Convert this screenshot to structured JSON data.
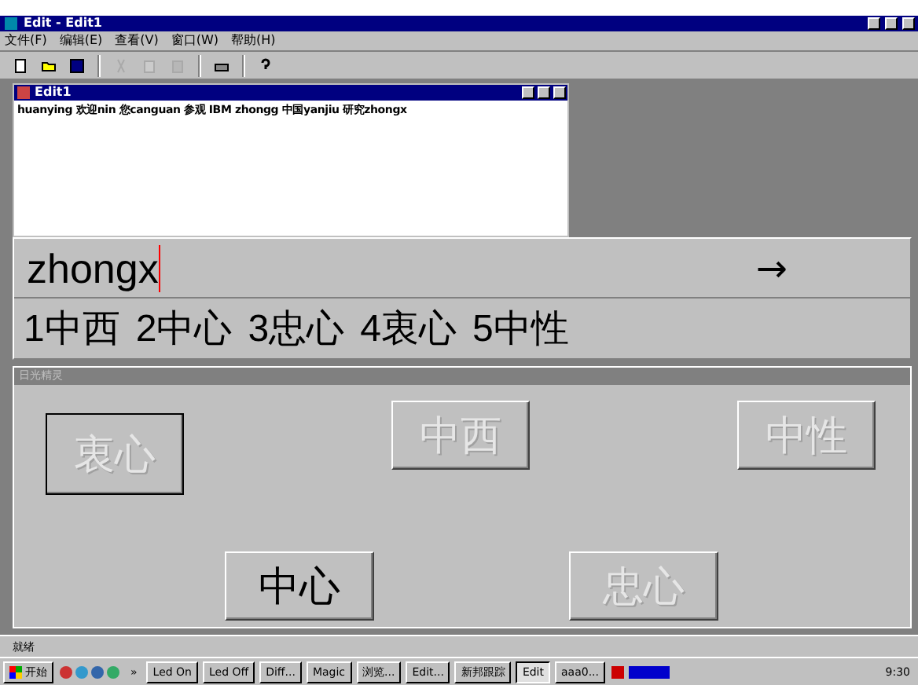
{
  "window": {
    "title": "Edit - Edit1"
  },
  "menu": [
    "文件(F)",
    "编辑(E)",
    "查看(V)",
    "窗口(W)",
    "帮助(H)"
  ],
  "toolbar": [
    {
      "kind": "new",
      "disabled": false
    },
    {
      "kind": "open",
      "disabled": false
    },
    {
      "kind": "save",
      "disabled": false
    },
    {
      "kind": "sep"
    },
    {
      "kind": "cut",
      "disabled": true
    },
    {
      "kind": "copy",
      "disabled": true
    },
    {
      "kind": "paste",
      "disabled": true
    },
    {
      "kind": "sep"
    },
    {
      "kind": "print",
      "disabled": false
    },
    {
      "kind": "sep"
    },
    {
      "kind": "help",
      "disabled": false
    }
  ],
  "child_window": {
    "title": "Edit1",
    "text": "huanying 欢迎nin 您canguan 参观 IBM zhongg 中国yanjiu 研究zhongx"
  },
  "ime": {
    "composition": "zhongx",
    "arrow": "→",
    "candidates": [
      "1中西",
      "2中心",
      "3忠心",
      "4衷心",
      "5中性"
    ]
  },
  "panel": {
    "title": "日光精灵",
    "rows": [
      [
        {
          "label": "衷心",
          "disabled": true,
          "focused": true
        },
        {
          "label": "中西",
          "disabled": true,
          "focused": false
        },
        {
          "label": "中性",
          "disabled": true,
          "focused": false
        }
      ],
      [
        {
          "label": "中心",
          "disabled": false,
          "focused": false
        },
        {
          "label": "忠心",
          "disabled": true,
          "focused": false
        }
      ]
    ]
  },
  "status_bar": "就绪",
  "taskbar": {
    "start": "开始",
    "more": "»",
    "items": [
      {
        "label": "Led On",
        "selected": false
      },
      {
        "label": "Led Off",
        "selected": false
      },
      {
        "label": "Diff...",
        "selected": false
      },
      {
        "label": "Magic",
        "selected": false
      },
      {
        "label": "浏览...",
        "selected": false
      },
      {
        "label": "Edit...",
        "selected": false
      },
      {
        "label": "新邦跟踪",
        "selected": false
      },
      {
        "label": "Edit",
        "selected": true
      },
      {
        "label": "aaa0...",
        "selected": false
      }
    ],
    "clock": "9:30"
  }
}
